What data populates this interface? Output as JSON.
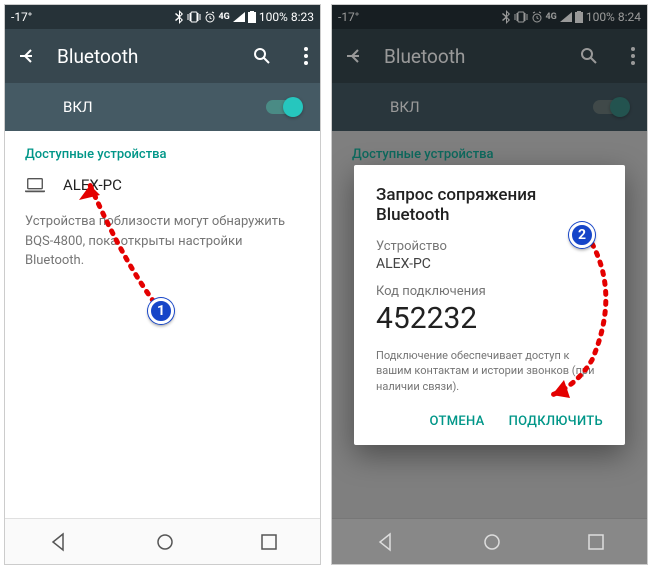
{
  "left": {
    "statusbar": {
      "temp": "-17°",
      "battery": "100%",
      "time": "8:23"
    },
    "appbar": {
      "title": "Bluetooth"
    },
    "toggle": {
      "label": "ВКЛ"
    },
    "section_header": "Доступные устройства",
    "device": {
      "name": "ALEX-PC"
    },
    "hint": "Устройства поблизости могут обнаружить BQS-4800, пока открыты настройки Bluetooth."
  },
  "right": {
    "statusbar": {
      "temp": "-17°",
      "battery": "100%",
      "time": "8:24"
    },
    "appbar": {
      "title": "Bluetooth"
    },
    "toggle": {
      "label": "ВКЛ"
    },
    "section_header": "Доступные устройства",
    "dialog": {
      "title": "Запрос сопряжения Bluetooth",
      "device_label": "Устройство",
      "device_name": "ALEX-PC",
      "code_label": "Код подключения",
      "code": "452232",
      "note": "Подключение обеспечивает доступ к вашим контактам и истории звонков (при наличии связи).",
      "cancel": "ОТМЕНА",
      "connect": "ПОДКЛЮЧИТЬ"
    }
  },
  "badges": {
    "one": "1",
    "two": "2"
  }
}
